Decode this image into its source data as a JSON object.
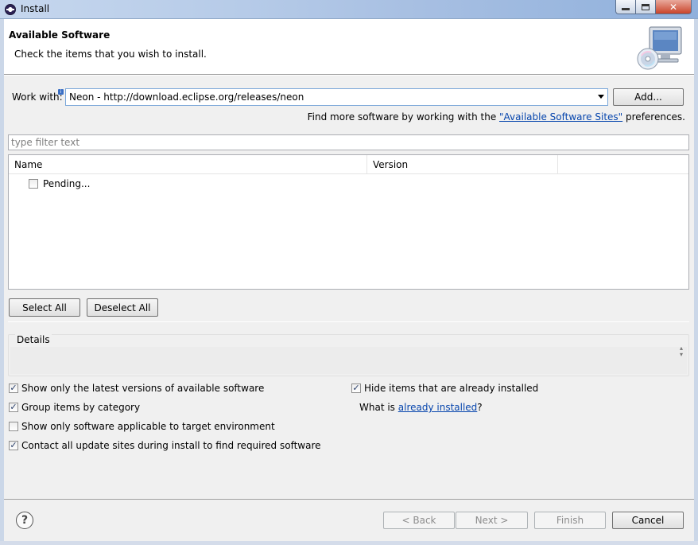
{
  "window": {
    "title": "Install",
    "minimize_label": "minimize",
    "maximize_label": "maximize",
    "close_label": "close"
  },
  "banner": {
    "title": "Available Software",
    "description": "Check the items that you wish to install.",
    "icon": "computer-cd-icon"
  },
  "work_with": {
    "label": "Work with:",
    "value": "Neon - http://download.eclipse.org/releases/neon",
    "add_label": "Add...",
    "find_more_prefix": "Find more software by working with the ",
    "find_more_link": "\"Available Software Sites\"",
    "find_more_suffix": " preferences."
  },
  "filter": {
    "placeholder": "type filter text"
  },
  "table": {
    "columns": [
      "Name",
      "Version",
      ""
    ],
    "rows": [
      {
        "label": "Pending...",
        "checked": false
      }
    ]
  },
  "selection": {
    "select_all": "Select All",
    "deselect_all": "Deselect All"
  },
  "details": {
    "label": "Details"
  },
  "options": {
    "latest_versions": {
      "label": "Show only the latest versions of available software",
      "checked": true
    },
    "group_by_category": {
      "label": "Group items by category",
      "checked": true
    },
    "target_env": {
      "label": "Show only software applicable to target environment",
      "checked": false
    },
    "contact_sites": {
      "label": "Contact all update sites during install to find required software",
      "checked": true
    },
    "hide_installed": {
      "label": "Hide items that are already installed",
      "checked": true
    },
    "what_is_prefix": "What is ",
    "what_is_link": "already installed",
    "what_is_suffix": "?"
  },
  "footer": {
    "help": "?",
    "back": "< Back",
    "next": "Next >",
    "finish": "Finish",
    "cancel": "Cancel"
  },
  "colors": {
    "link": "#0645ad",
    "dialog_bg": "#f0f0f0",
    "combo_border": "#7aa7d9"
  }
}
